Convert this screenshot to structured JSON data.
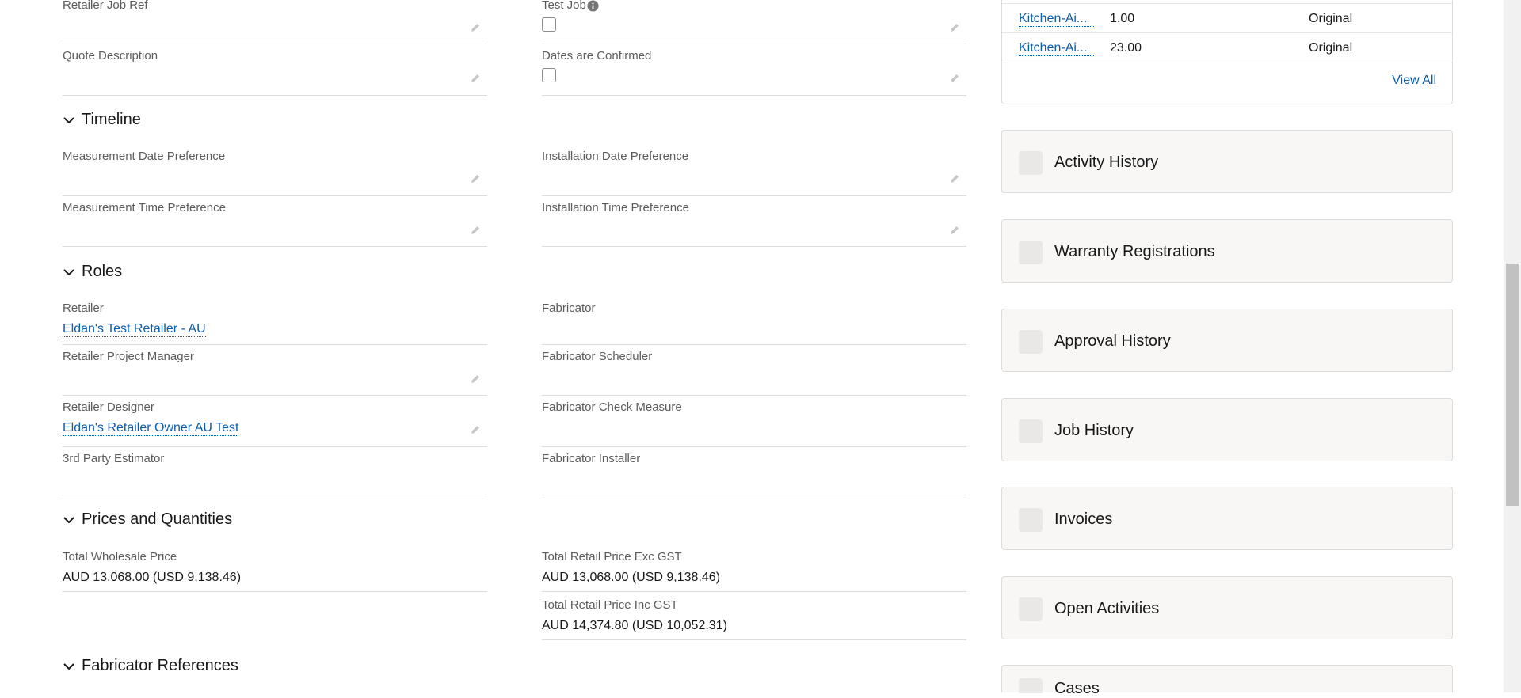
{
  "left_fields": {
    "retailer_job_ref": {
      "label": "Retailer Job Ref",
      "value": ""
    },
    "quote_description": {
      "label": "Quote Description",
      "value": ""
    },
    "test_job": {
      "label": "Test Job",
      "checked": false
    },
    "dates_confirmed": {
      "label": "Dates are Confirmed",
      "checked": false
    }
  },
  "timeline": {
    "title": "Timeline",
    "measurement_date": {
      "label": "Measurement Date Preference",
      "value": ""
    },
    "installation_date": {
      "label": "Installation Date Preference",
      "value": ""
    },
    "measurement_time": {
      "label": "Measurement Time Preference",
      "value": ""
    },
    "installation_time": {
      "label": "Installation Time Preference",
      "value": ""
    }
  },
  "roles": {
    "title": "Roles",
    "retailer": {
      "label": "Retailer",
      "value": "Eldan's Test Retailer - AU"
    },
    "fabricator": {
      "label": "Fabricator",
      "value": ""
    },
    "retailer_pm": {
      "label": "Retailer Project Manager",
      "value": ""
    },
    "fabricator_scheduler": {
      "label": "Fabricator Scheduler",
      "value": ""
    },
    "retailer_designer": {
      "label": "Retailer Designer",
      "value": "Eldan's Retailer Owner AU Test"
    },
    "fabricator_check": {
      "label": "Fabricator Check Measure",
      "value": ""
    },
    "third_party": {
      "label": "3rd Party Estimator",
      "value": ""
    },
    "fabricator_installer": {
      "label": "Fabricator Installer",
      "value": ""
    }
  },
  "prices": {
    "title": "Prices and Quantities",
    "total_wholesale": {
      "label": "Total Wholesale Price",
      "value": "AUD 13,068.00 (USD 9,138.46)"
    },
    "total_retail_exc": {
      "label": "Total Retail Price Exc GST",
      "value": "AUD 13,068.00 (USD 9,138.46)"
    },
    "total_retail_inc": {
      "label": "Total Retail Price Inc GST",
      "value": "AUD 14,374.80 (USD 10,052.31)"
    }
  },
  "fabricator_refs": {
    "title": "Fabricator References"
  },
  "related_list": {
    "rows": [
      {
        "name": "Kitchen-Ai...",
        "qty": "1.00",
        "status": "Original"
      },
      {
        "name": "Kitchen-Ai...",
        "qty": "23.00",
        "status": "Original"
      }
    ],
    "view_all": "View All"
  },
  "cards": [
    {
      "title": "Activity History"
    },
    {
      "title": "Warranty Registrations"
    },
    {
      "title": "Approval History"
    },
    {
      "title": "Job History"
    },
    {
      "title": "Invoices"
    },
    {
      "title": "Open Activities"
    },
    {
      "title": "Cases"
    }
  ],
  "colors": {
    "link": "#0b5cab",
    "border": "#dddbda",
    "card_bg": "#f8f7f6"
  }
}
